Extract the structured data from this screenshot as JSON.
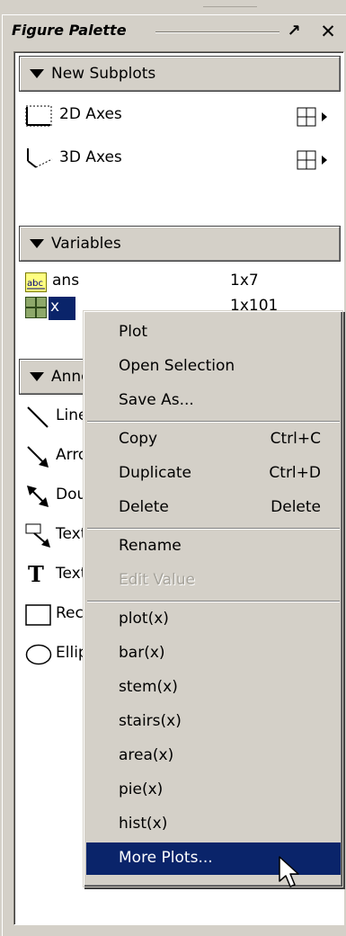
{
  "palette": {
    "title": "Figure Palette",
    "undock_glyph": "↗",
    "close_glyph": "✕"
  },
  "new_subplots": {
    "header": "New Subplots",
    "items": [
      {
        "label": "2D Axes",
        "icon": "2d-axes-icon"
      },
      {
        "label": "3D Axes",
        "icon": "3d-axes-icon"
      }
    ]
  },
  "variables": {
    "header": "Variables",
    "items": [
      {
        "name": "ans",
        "size": "1x7",
        "icon": "char-array-icon"
      },
      {
        "name": "x",
        "size": "1x101",
        "icon": "matrix-icon"
      }
    ]
  },
  "annotations": {
    "header": "Annotations",
    "items": [
      {
        "label": "Line",
        "icon": "line-icon"
      },
      {
        "label": "Arrow",
        "icon": "arrow-icon"
      },
      {
        "label": "Double Arrow",
        "icon": "double-arrow-icon"
      },
      {
        "label": "Text Arrow",
        "icon": "text-arrow-icon"
      },
      {
        "label": "Text Box",
        "icon": "text-box-icon"
      },
      {
        "label": "Rectangle",
        "icon": "rectangle-icon"
      },
      {
        "label": "Ellipse",
        "icon": "ellipse-icon"
      }
    ]
  },
  "context_menu": {
    "groups": [
      [
        {
          "label": "Plot"
        },
        {
          "label": "Open Selection"
        },
        {
          "label": "Save As..."
        }
      ],
      [
        {
          "label": "Copy",
          "shortcut": "Ctrl+C"
        },
        {
          "label": "Duplicate",
          "shortcut": "Ctrl+D"
        },
        {
          "label": "Delete",
          "shortcut": "Delete"
        }
      ],
      [
        {
          "label": "Rename"
        },
        {
          "label": "Edit Value",
          "disabled": true
        }
      ],
      [
        {
          "label": "plot(x)"
        },
        {
          "label": "bar(x)"
        },
        {
          "label": "stem(x)"
        },
        {
          "label": "stairs(x)"
        },
        {
          "label": "area(x)"
        },
        {
          "label": "pie(x)"
        },
        {
          "label": "hist(x)"
        },
        {
          "label": "More Plots...",
          "selected": true
        }
      ]
    ]
  },
  "colors": {
    "panel_bg": "#d4d0c8",
    "selection": "#0a246a",
    "disabled_text": "#a6a39b"
  }
}
